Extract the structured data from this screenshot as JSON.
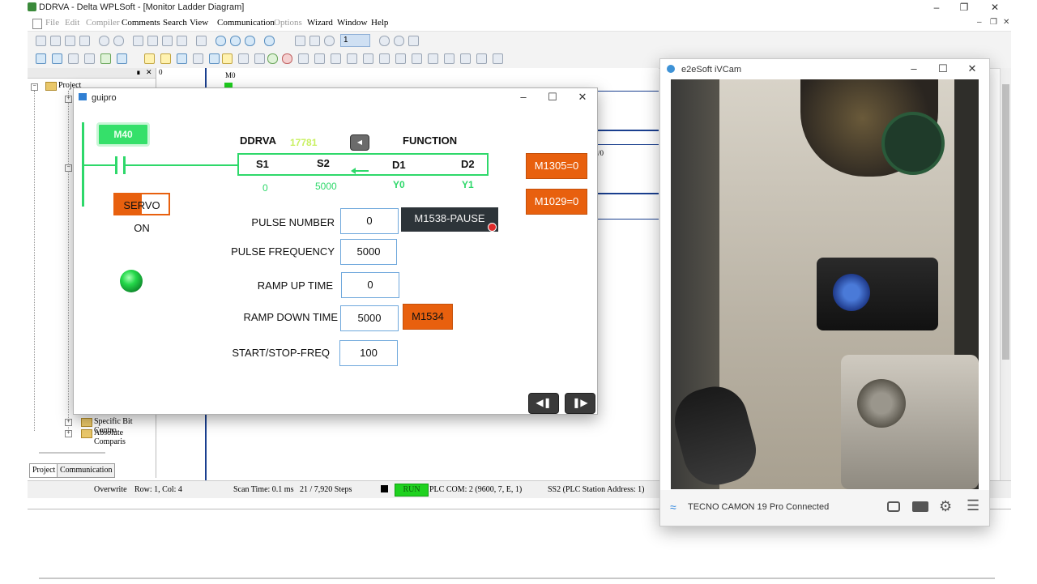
{
  "app": {
    "title": "DDRVA - Delta WPLSoft - [Monitor Ladder Diagram]"
  },
  "menu": [
    "File",
    "Edit",
    "Compiler",
    "Comments",
    "Search",
    "View",
    "Communication",
    "Options",
    "Wizard",
    "Window",
    "Help"
  ],
  "toolbar": {
    "step_value": "1"
  },
  "project_tree": {
    "root": "Project",
    "items": [
      "Specific Bit Contro",
      "Absolute Comparis"
    ],
    "tabs": [
      "Project",
      "Communication"
    ]
  },
  "ladder": {
    "contact_label": "M0",
    "row_value": "0",
    "partial_text": "/0"
  },
  "status_bar": {
    "mode": "Overwrite",
    "position": "Row: 1, Col: 4",
    "scan_time": "Scan Time: 0.1 ms",
    "steps": "21 / 7,920 Steps",
    "run": "RUN",
    "com": "PLC COM: 2 (9600, 7, E, 1)",
    "station": "SS2 (PLC Station Address: 1)"
  },
  "guipro": {
    "title": "guipro",
    "m40": "M40",
    "instruction": "DDRVA",
    "step": "17781",
    "function_label": "FUNCTION",
    "operands": [
      {
        "name": "S1",
        "value": "0"
      },
      {
        "name": "S2",
        "value": "5000"
      },
      {
        "name": "D1",
        "value": "Y0"
      },
      {
        "name": "D2",
        "value": "Y1"
      }
    ],
    "servo_on": "SERVO ON",
    "m1305": "M1305=0",
    "m1029": "M1029=0",
    "fields": [
      {
        "label": "PULSE NUMBER",
        "value": "0"
      },
      {
        "label": "PULSE FREQUENCY",
        "value": "5000"
      },
      {
        "label": "RAMP UP TIME",
        "value": "0"
      },
      {
        "label": "RAMP DOWN TIME",
        "value": "5000"
      },
      {
        "label": "START/STOP-FREQ",
        "value": "100"
      }
    ],
    "pause_button": "M1538-PAUSE",
    "m1534": "M1534"
  },
  "ivcam": {
    "title": "e2eSoft iVCam",
    "status": "TECNO CAMON 19 Pro Connected"
  },
  "colors": {
    "accent_orange": "#e8600e",
    "plc_green": "#2ed86a",
    "run_green": "#1fd11f",
    "pause_bg": "#2d3439"
  }
}
